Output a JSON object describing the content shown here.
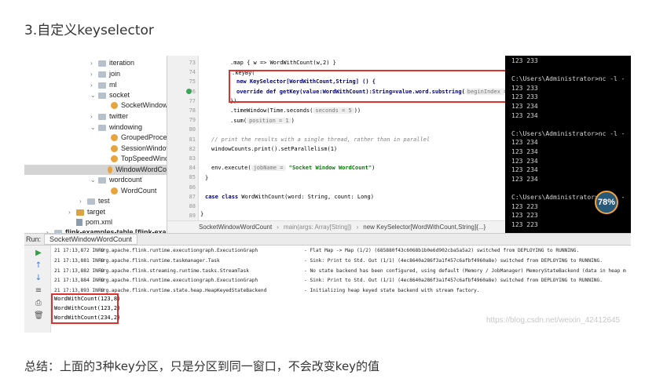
{
  "heading": "3.自定义keyselector",
  "footer": "总结：上面的3种key分区，只是分区到同一窗口，不会改变key的值",
  "tree": [
    {
      "label": "iteration",
      "kind": "folder",
      "arrow": "›"
    },
    {
      "label": "join",
      "kind": "folder",
      "arrow": "›"
    },
    {
      "label": "ml",
      "kind": "folder",
      "arrow": "›"
    },
    {
      "label": "socket",
      "kind": "folder",
      "arrow": "⌄"
    },
    {
      "label": "SocketWindowW",
      "kind": "class",
      "arrow": ""
    },
    {
      "label": "twitter",
      "kind": "folder",
      "arrow": "›"
    },
    {
      "label": "windowing",
      "kind": "folder",
      "arrow": "⌄"
    },
    {
      "label": "GroupedProces",
      "kind": "class",
      "arrow": ""
    },
    {
      "label": "SessionWindow",
      "kind": "class",
      "arrow": ""
    },
    {
      "label": "TopSpeedWindo",
      "kind": "class",
      "arrow": ""
    },
    {
      "label": "WindowWordCo",
      "kind": "class",
      "arrow": ""
    },
    {
      "label": "wordcount",
      "kind": "folder",
      "arrow": "⌄"
    },
    {
      "label": "WordCount",
      "kind": "class",
      "arrow": ""
    },
    {
      "label": "test",
      "kind": "folder",
      "arrow": "›"
    },
    {
      "label": "target",
      "kind": "folder-o",
      "arrow": "›"
    },
    {
      "label": "pom.xml",
      "kind": "file",
      "arrow": ""
    },
    {
      "label": "flink-examples-table [flink-example",
      "kind": "folder",
      "arrow": "›"
    }
  ],
  "editor": {
    "lines": [
      "73",
      "74",
      "75",
      "76",
      "77",
      "78",
      "79",
      "80",
      "81",
      "82",
      "83",
      "84",
      "85",
      "86",
      "87",
      "88",
      "89",
      "90",
      "91"
    ],
    "code": {
      "l73": ".map { w => WordWithCount(w,2) }",
      "l74": ".keyBy(",
      "l75a": "new KeySelector[WordWithCount,String] () {",
      "l76a": "override  def getKey(value:WordWithCount):String=value.word.substring(",
      "l76h": "beginIndex = 1",
      "l76b": ")",
      "l77": "})",
      "l78a": ".timeWindow(Time.seconds(",
      "l78h": "seconds = 5",
      "l78b": "))",
      "l79a": ".sum(",
      "l79h": "position = 1",
      "l79b": ")",
      "l81": "// print the results with a single thread, rather than in parallel",
      "l82": "windowCounts.print().setParallelism(1)",
      "l84a": "env.execute(",
      "l84h": "jobName =",
      "l84s": "\"Socket Window WordCount\"",
      "l84b": ")",
      "l85": "}",
      "l87a": "case class",
      "l87b": "WordWithCount(word: String, count: Long)",
      "l89": "}"
    },
    "breadcrumb": [
      "SocketWindowWordCount",
      "main(args: Array[String])",
      "new KeySelector[WordWithCount,String]{...}"
    ]
  },
  "cmd": [
    "123 233",
    "",
    "C:\\Users\\Administrator>nc -l -",
    "123 233",
    "123 233",
    "123 234",
    "123 234",
    "",
    "C:\\Users\\Administrator>nc -l -",
    "123 234",
    "123 234",
    "123 234",
    "123 234",
    "123 234",
    "",
    "C:\\Users\\Administrator>nc -l -",
    "123 223",
    "123 223",
    "123 223"
  ],
  "badge": "78%",
  "run": {
    "prefix": "Run:",
    "tab": "SocketWindowWordCount"
  },
  "log": [
    {
      "t": "21 17:13,872 INFO",
      "c": "org.apache.flink.runtime.executiongraph.ExecutionGraph",
      "m": "- Flat Map -> Map (1/2) (685880f43c6068b1b0e6d902cba5a5a2) switched from DEPLOYING to RUNNING."
    },
    {
      "t": "21 17:13,881 INFO",
      "c": "org.apache.flink.runtime.taskmanager.Task",
      "m": "- Sink: Print to Std. Out (1/1) (4ec8640a286f3a1f457c6afbf4960a8e) switched from DEPLOYING to RUNNING."
    },
    {
      "t": "21 17:13,882 INFO",
      "c": "org.apache.flink.streaming.runtime.tasks.StreamTask",
      "m": "- No state backend has been configured, using default (Memory / JobManager) MemoryStateBackend (data in heap m"
    },
    {
      "t": "21 17:13,884 INFO",
      "c": "org.apache.flink.runtime.executiongraph.ExecutionGraph",
      "m": "- Sink: Print to Std. Out (1/1) (4ec8640a286f3a1f457c6afbf4960a8e) switched from DEPLOYING to RUNNING."
    },
    {
      "t": "21 17:13,893 INFO",
      "c": "org.apache.flink.runtime.state.heap.HeapKeyedStateBackend",
      "m": "- Initializing heap keyed state backend with stream factory."
    }
  ],
  "results": [
    "WordWithCount(123,8)",
    "WordWithCount(123,2)",
    "WordWithCount(234,2)"
  ],
  "watermark": "https://blog.csdn.net/weixin_42412645"
}
